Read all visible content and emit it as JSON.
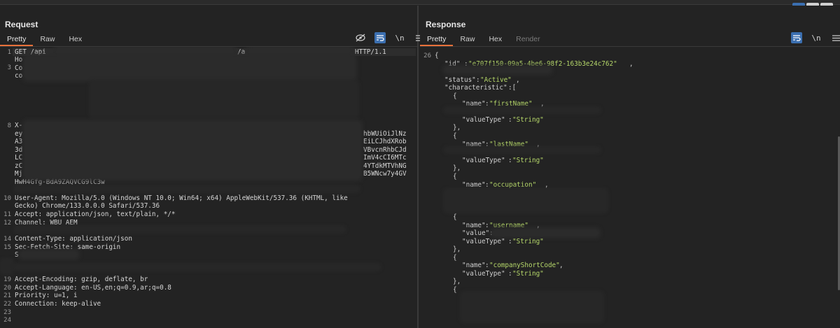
{
  "layout_toggles": [
    {
      "name": "split-vertical",
      "active": true
    },
    {
      "name": "split-horizontal",
      "active": false
    },
    {
      "name": "single-pane",
      "active": false
    }
  ],
  "request": {
    "title": "Request",
    "tabs": [
      {
        "label": "Pretty",
        "active": true
      },
      {
        "label": "Raw",
        "active": false
      },
      {
        "label": "Hex",
        "active": false
      }
    ],
    "tool_newline": "\\n",
    "lines": [
      {
        "num": "1",
        "text": "GET /api",
        "tail_a": "/a",
        "tail_b": "HTTP/1.1"
      },
      {
        "num": "",
        "text": "Ho"
      },
      {
        "num": "3",
        "text": "Co"
      },
      {
        "num": "",
        "text": "co"
      },
      {
        "num": "8",
        "text": "X-"
      },
      {
        "num": "",
        "text": "ey",
        "tail": "hbWUiOiJlNz"
      },
      {
        "num": "",
        "text": "A3",
        "tail": "EiLCJhdXRob"
      },
      {
        "num": "",
        "text": "3d",
        "tail": "VBvcnRhbCJd"
      },
      {
        "num": "",
        "text": "LC",
        "tail": "ImV4cCI6MTc"
      },
      {
        "num": "",
        "text": "zC",
        "tail": "4YTdkMTVhNG"
      },
      {
        "num": "",
        "text": "Mj",
        "tail": "B5WNcw7y4GV"
      },
      {
        "num": "",
        "text": "HwH4Gfg-BdA9ZAQVCG9lC3w"
      },
      {
        "num": "10",
        "text": "User-Agent: Mozilla/5.0 (Windows NT 10.0; Win64; x64) AppleWebKit/537.36 (KHTML, like"
      },
      {
        "num": "",
        "text": "Gecko) Chrome/133.0.0.0 Safari/537.36"
      },
      {
        "num": "11",
        "text": "Accept: application/json, text/plain, */*"
      },
      {
        "num": "12",
        "text": "Channel: WBU AEM"
      },
      {
        "num": "14",
        "text": "Content-Type: application/json"
      },
      {
        "num": "15",
        "text": "Sec-Fetch-Site: same-origin"
      },
      {
        "num": "",
        "text": "S"
      },
      {
        "num": "19",
        "text": "Accept-Encoding: gzip, deflate, br"
      },
      {
        "num": "20",
        "text": "Accept-Language: en-US,en;q=0.9,ar;q=0.8"
      },
      {
        "num": "21",
        "text": "Priority: u=1, i"
      },
      {
        "num": "22",
        "text": "Connection: keep-alive"
      },
      {
        "num": "23",
        "text": ""
      },
      {
        "num": "24",
        "text": ""
      }
    ]
  },
  "response": {
    "title": "Response",
    "tabs": [
      {
        "label": "Pretty",
        "active": true
      },
      {
        "label": "Raw",
        "active": false
      },
      {
        "label": "Hex",
        "active": false
      },
      {
        "label": "Render",
        "active": false,
        "disabled": true
      }
    ],
    "tool_newline": "\\n",
    "line_numbers": [
      "26"
    ],
    "json": {
      "open": "{",
      "id_key": "\"id\"",
      "id_val": "\"e707f150-09a5-4be6-98f2-163b3e24c762\"",
      "status_key": "\"status\"",
      "status_val": "\"Active\"",
      "characteristic_key": "\"characteristic\"",
      "name_key": "\"name\"",
      "value_key": "\"value\"",
      "valuetype_key": "\"valueType\"",
      "string_val": "\"String\"",
      "names": [
        "\"firstName\"",
        "\"lastName\"",
        "\"occupation\"",
        "\"username\"",
        "\"companyShortCode\""
      ]
    }
  }
}
